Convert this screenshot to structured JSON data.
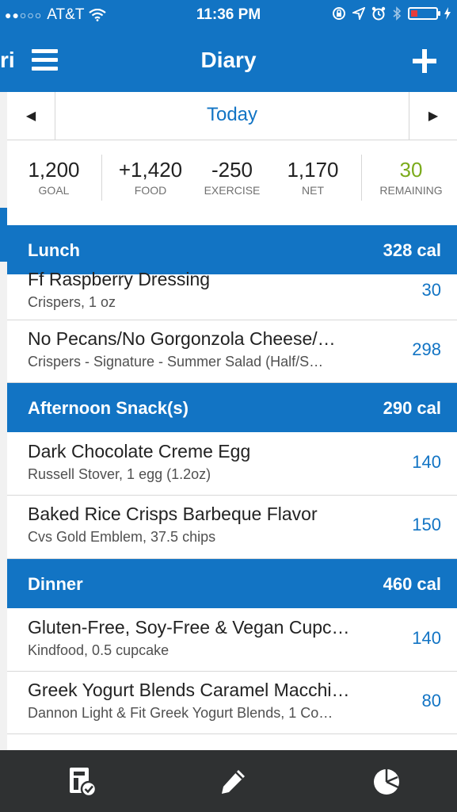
{
  "status_bar": {
    "carrier": "AT&T",
    "time": "11:36 PM",
    "battery_level": 0.25,
    "battery_color": "#e63c3c"
  },
  "nav": {
    "title": "Diary",
    "edge_text": "ri",
    "menu_icon": "hamburger-icon",
    "add_icon": "plus-icon"
  },
  "date_bar": {
    "label": "Today",
    "prev_icon": "left-triangle-icon",
    "next_icon": "right-triangle-icon"
  },
  "summary": {
    "goal": {
      "value": "1,200",
      "label": "GOAL"
    },
    "food": {
      "value": "+1,420",
      "label": "FOOD"
    },
    "exercise": {
      "value": "-250",
      "label": "EXERCISE"
    },
    "net": {
      "value": "1,170",
      "label": "NET"
    },
    "remaining": {
      "value": "30",
      "label": "REMAINING",
      "color": "#7bab1c"
    }
  },
  "sections": [
    {
      "name": "Lunch",
      "calories": "328 cal",
      "entries": [
        {
          "name": "Ff Raspberry Dressing",
          "detail": "Crispers, 1 oz",
          "calories": "30"
        },
        {
          "name": "No Pecans/No Gorgonzola Cheese/…",
          "detail": "Crispers - Signature - Summer Salad (Half/S…",
          "calories": "298"
        }
      ]
    },
    {
      "name": "Afternoon Snack(s)",
      "calories": "290 cal",
      "entries": [
        {
          "name": "Dark Chocolate Creme Egg",
          "detail": "Russell Stover, 1 egg (1.2oz)",
          "calories": "140"
        },
        {
          "name": "Baked Rice Crisps Barbeque Flavor",
          "detail": "Cvs Gold Emblem, 37.5 chips",
          "calories": "150"
        }
      ]
    },
    {
      "name": "Dinner",
      "calories": "460 cal",
      "entries": [
        {
          "name": "Gluten-Free, Soy-Free & Vegan Cupc…",
          "detail": "Kindfood, 0.5 cupcake",
          "calories": "140"
        },
        {
          "name": "Greek Yogurt Blends Caramel Macchi…",
          "detail": "Dannon Light & Fit Greek Yogurt Blends, 1 Co…",
          "calories": "80"
        }
      ]
    }
  ],
  "tab_bar": {
    "items": [
      "diary-icon",
      "edit-icon",
      "pie-chart-icon"
    ]
  },
  "colors": {
    "brand": "#1274c4",
    "remaining": "#7bab1c"
  }
}
